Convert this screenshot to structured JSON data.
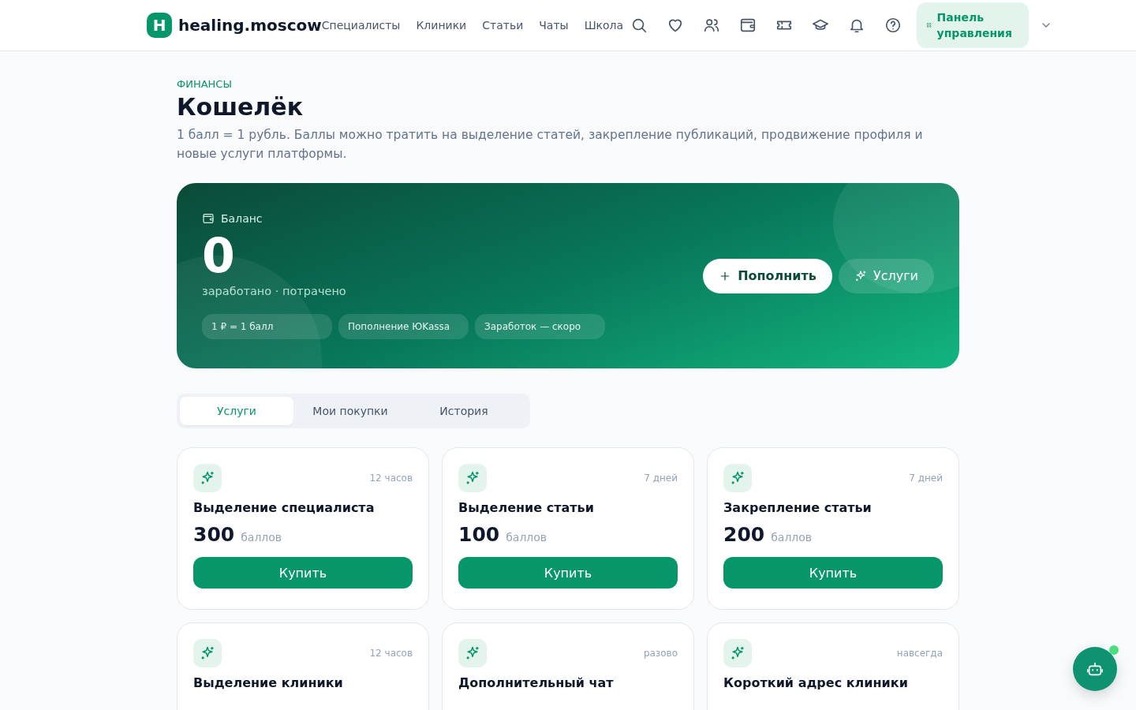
{
  "header": {
    "logo_letter": "H",
    "site_name": "healing.moscow",
    "nav": [
      "Специалисты",
      "Клиники",
      "Статьи",
      "Чаты",
      "Школа"
    ],
    "dashboard_button": "Панель управления"
  },
  "page": {
    "section_label": "ФИНАНСЫ",
    "title": "Кошелёк",
    "description": "1 балл = 1 рубль. Баллы можно тратить на выделение статей, закрепление публикаций, продвижение профиля и новые услуги платформы."
  },
  "balance": {
    "label": "Баланс",
    "amount": "0",
    "subtitle": "заработано · потрачено",
    "chips": [
      "1 ₽ = 1 балл",
      "Пополнение ЮKassa",
      "Заработок — скоро"
    ],
    "actions": [
      {
        "label": "Пополнить",
        "kind": "primary"
      },
      {
        "label": "Услуги",
        "kind": "secondary"
      }
    ]
  },
  "tabs": [
    {
      "label": "Услуги",
      "selected": true
    },
    {
      "label": "Мои покупки",
      "selected": false
    },
    {
      "label": "История",
      "selected": false
    }
  ],
  "services": [
    {
      "duration": "12 часов",
      "title": "Выделение специалиста",
      "price": "300",
      "unit": "баллов",
      "button": "Купить"
    },
    {
      "duration": "7 дней",
      "title": "Выделение статьи",
      "price": "100",
      "unit": "баллов",
      "button": "Купить"
    },
    {
      "duration": "7 дней",
      "title": "Закрепление статьи",
      "price": "200",
      "unit": "баллов",
      "button": "Купить"
    },
    {
      "duration": "12 часов",
      "title": "Выделение клиники"
    },
    {
      "duration": "разово",
      "title": "Дополнительный чат"
    },
    {
      "duration": "навсегда",
      "title": "Короткий адрес клиники"
    }
  ]
}
